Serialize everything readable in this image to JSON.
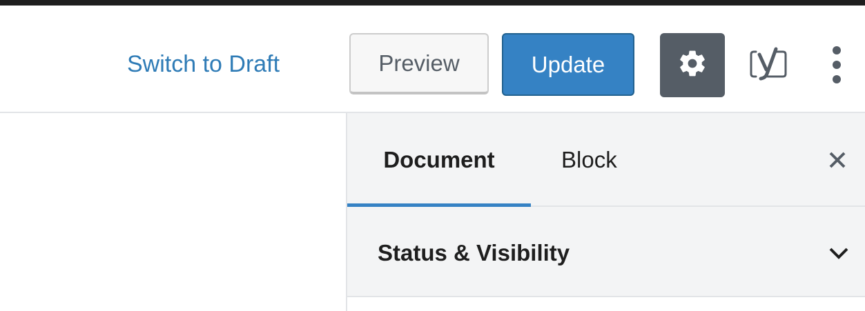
{
  "header": {
    "switch_to_draft_label": "Switch to Draft",
    "preview_label": "Preview",
    "update_label": "Update",
    "settings_icon": "gear-icon",
    "yoast_icon": "yoast-icon",
    "more_icon": "more-vertical-icon"
  },
  "sidebar": {
    "tabs": [
      {
        "label": "Document",
        "active": true
      },
      {
        "label": "Block",
        "active": false
      }
    ],
    "close_icon": "close-icon",
    "panels": [
      {
        "title": "Status & Visibility",
        "expanded": true,
        "icon": "chevron-down-icon"
      }
    ]
  },
  "colors": {
    "accent": "#3582c4",
    "link": "#2e7bb6",
    "settings_button_bg": "#555d66",
    "sidebar_bg": "#f3f4f5",
    "top_border": "#1e1e1e"
  }
}
